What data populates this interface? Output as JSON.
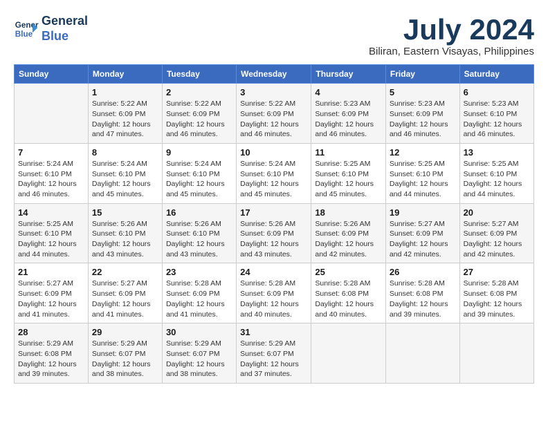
{
  "header": {
    "logo_line1": "General",
    "logo_line2": "Blue",
    "month_year": "July 2024",
    "location": "Biliran, Eastern Visayas, Philippines"
  },
  "weekdays": [
    "Sunday",
    "Monday",
    "Tuesday",
    "Wednesday",
    "Thursday",
    "Friday",
    "Saturday"
  ],
  "weeks": [
    [
      {
        "day": "",
        "info": ""
      },
      {
        "day": "1",
        "info": "Sunrise: 5:22 AM\nSunset: 6:09 PM\nDaylight: 12 hours\nand 47 minutes."
      },
      {
        "day": "2",
        "info": "Sunrise: 5:22 AM\nSunset: 6:09 PM\nDaylight: 12 hours\nand 46 minutes."
      },
      {
        "day": "3",
        "info": "Sunrise: 5:22 AM\nSunset: 6:09 PM\nDaylight: 12 hours\nand 46 minutes."
      },
      {
        "day": "4",
        "info": "Sunrise: 5:23 AM\nSunset: 6:09 PM\nDaylight: 12 hours\nand 46 minutes."
      },
      {
        "day": "5",
        "info": "Sunrise: 5:23 AM\nSunset: 6:09 PM\nDaylight: 12 hours\nand 46 minutes."
      },
      {
        "day": "6",
        "info": "Sunrise: 5:23 AM\nSunset: 6:10 PM\nDaylight: 12 hours\nand 46 minutes."
      }
    ],
    [
      {
        "day": "7",
        "info": "Sunrise: 5:24 AM\nSunset: 6:10 PM\nDaylight: 12 hours\nand 46 minutes."
      },
      {
        "day": "8",
        "info": "Sunrise: 5:24 AM\nSunset: 6:10 PM\nDaylight: 12 hours\nand 45 minutes."
      },
      {
        "day": "9",
        "info": "Sunrise: 5:24 AM\nSunset: 6:10 PM\nDaylight: 12 hours\nand 45 minutes."
      },
      {
        "day": "10",
        "info": "Sunrise: 5:24 AM\nSunset: 6:10 PM\nDaylight: 12 hours\nand 45 minutes."
      },
      {
        "day": "11",
        "info": "Sunrise: 5:25 AM\nSunset: 6:10 PM\nDaylight: 12 hours\nand 45 minutes."
      },
      {
        "day": "12",
        "info": "Sunrise: 5:25 AM\nSunset: 6:10 PM\nDaylight: 12 hours\nand 44 minutes."
      },
      {
        "day": "13",
        "info": "Sunrise: 5:25 AM\nSunset: 6:10 PM\nDaylight: 12 hours\nand 44 minutes."
      }
    ],
    [
      {
        "day": "14",
        "info": "Sunrise: 5:25 AM\nSunset: 6:10 PM\nDaylight: 12 hours\nand 44 minutes."
      },
      {
        "day": "15",
        "info": "Sunrise: 5:26 AM\nSunset: 6:10 PM\nDaylight: 12 hours\nand 43 minutes."
      },
      {
        "day": "16",
        "info": "Sunrise: 5:26 AM\nSunset: 6:10 PM\nDaylight: 12 hours\nand 43 minutes."
      },
      {
        "day": "17",
        "info": "Sunrise: 5:26 AM\nSunset: 6:09 PM\nDaylight: 12 hours\nand 43 minutes."
      },
      {
        "day": "18",
        "info": "Sunrise: 5:26 AM\nSunset: 6:09 PM\nDaylight: 12 hours\nand 42 minutes."
      },
      {
        "day": "19",
        "info": "Sunrise: 5:27 AM\nSunset: 6:09 PM\nDaylight: 12 hours\nand 42 minutes."
      },
      {
        "day": "20",
        "info": "Sunrise: 5:27 AM\nSunset: 6:09 PM\nDaylight: 12 hours\nand 42 minutes."
      }
    ],
    [
      {
        "day": "21",
        "info": "Sunrise: 5:27 AM\nSunset: 6:09 PM\nDaylight: 12 hours\nand 41 minutes."
      },
      {
        "day": "22",
        "info": "Sunrise: 5:27 AM\nSunset: 6:09 PM\nDaylight: 12 hours\nand 41 minutes."
      },
      {
        "day": "23",
        "info": "Sunrise: 5:28 AM\nSunset: 6:09 PM\nDaylight: 12 hours\nand 41 minutes."
      },
      {
        "day": "24",
        "info": "Sunrise: 5:28 AM\nSunset: 6:09 PM\nDaylight: 12 hours\nand 40 minutes."
      },
      {
        "day": "25",
        "info": "Sunrise: 5:28 AM\nSunset: 6:08 PM\nDaylight: 12 hours\nand 40 minutes."
      },
      {
        "day": "26",
        "info": "Sunrise: 5:28 AM\nSunset: 6:08 PM\nDaylight: 12 hours\nand 39 minutes."
      },
      {
        "day": "27",
        "info": "Sunrise: 5:28 AM\nSunset: 6:08 PM\nDaylight: 12 hours\nand 39 minutes."
      }
    ],
    [
      {
        "day": "28",
        "info": "Sunrise: 5:29 AM\nSunset: 6:08 PM\nDaylight: 12 hours\nand 39 minutes."
      },
      {
        "day": "29",
        "info": "Sunrise: 5:29 AM\nSunset: 6:07 PM\nDaylight: 12 hours\nand 38 minutes."
      },
      {
        "day": "30",
        "info": "Sunrise: 5:29 AM\nSunset: 6:07 PM\nDaylight: 12 hours\nand 38 minutes."
      },
      {
        "day": "31",
        "info": "Sunrise: 5:29 AM\nSunset: 6:07 PM\nDaylight: 12 hours\nand 37 minutes."
      },
      {
        "day": "",
        "info": ""
      },
      {
        "day": "",
        "info": ""
      },
      {
        "day": "",
        "info": ""
      }
    ]
  ]
}
